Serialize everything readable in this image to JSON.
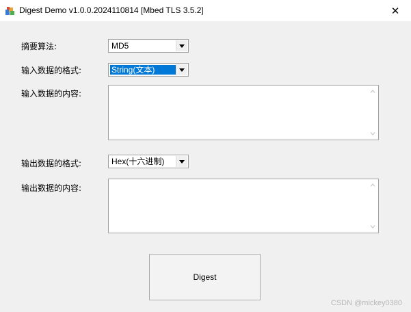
{
  "window": {
    "title": "Digest Demo v1.0.0.2024110814 [Mbed TLS 3.5.2]",
    "close_glyph": "✕"
  },
  "form": {
    "algorithm_label": "摘要算法:",
    "algorithm_value": "MD5",
    "input_format_label": "输入数据的格式:",
    "input_format_value": "String(文本)",
    "input_content_label": "输入数据的内容:",
    "input_content_value": "",
    "output_format_label": "输出数据的格式:",
    "output_format_value": "Hex(十六进制)",
    "output_content_label": "输出数据的内容:",
    "output_content_value": ""
  },
  "digest_button_label": "Digest",
  "watermark": "CSDN @mickey0380",
  "colors": {
    "selection": "#0078d7",
    "background": "#f0f0f0"
  },
  "icons": {
    "app": "app-icon",
    "close": "close-icon",
    "dropdown": "chevron-down-icon",
    "scroll_up": "scroll-up-icon",
    "scroll_down": "scroll-down-icon"
  }
}
